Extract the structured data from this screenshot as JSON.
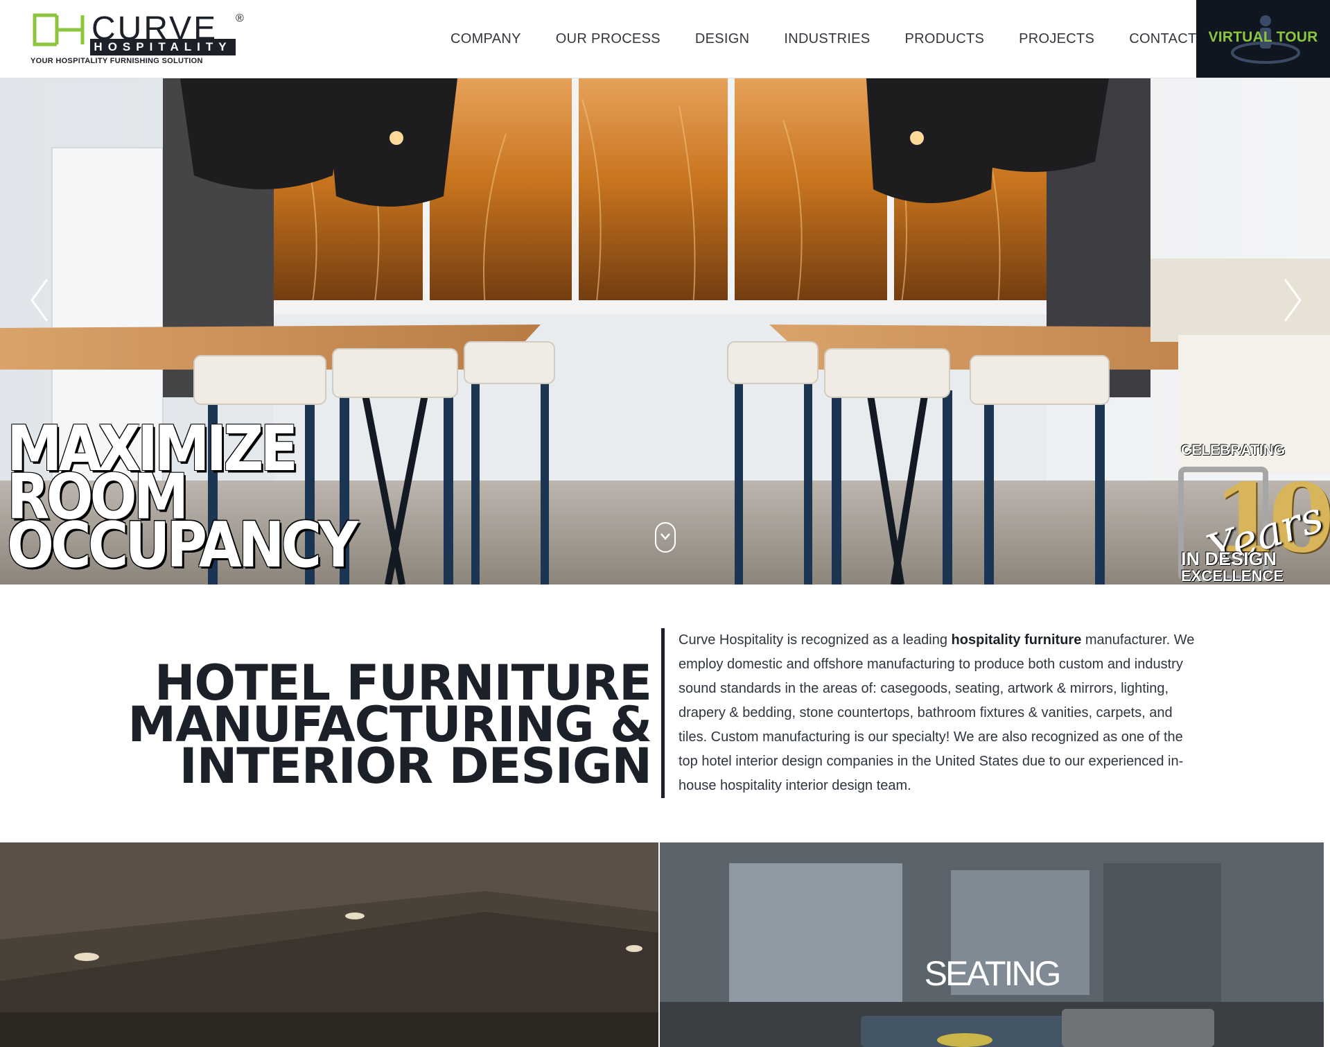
{
  "brand": {
    "name": "CURVE",
    "sub": "HOSPITALITY",
    "registered": "®",
    "tagline": "YOUR HOSPITALITY FURNISHING SOLUTION"
  },
  "nav": {
    "items": [
      {
        "label": "COMPANY"
      },
      {
        "label": "OUR PROCESS"
      },
      {
        "label": "DESIGN"
      },
      {
        "label": "INDUSTRIES"
      },
      {
        "label": "PRODUCTS"
      },
      {
        "label": "PROJECTS"
      },
      {
        "label": "CONTACT"
      }
    ],
    "virtual_tour": "VIRTUAL TOUR"
  },
  "hero": {
    "headline_lines": [
      "MAXIMIZE",
      "ROOM",
      "OCCUPANCY"
    ],
    "badge": {
      "top": "CELEBRATING",
      "number": "10",
      "script": "Years",
      "bottom1": "IN DESIGN",
      "bottom2": "EXCELLENCE"
    }
  },
  "intro": {
    "title_lines": [
      "HOTEL FURNITURE",
      "MANUFACTURING &",
      "INTERIOR DESIGN"
    ],
    "text_before": "Curve Hospitality is recognized as a leading ",
    "text_bold": "hospitality furniture",
    "text_after": " manufacturer. We employ domestic and offshore manufacturing to produce both custom and industry sound standards in the areas of: casegoods, seating, artwork & mirrors, lighting, drapery & bedding, stone countertops, bathroom fixtures & vanities, carpets, and tiles. Custom manufacturing is our specialty! We are also recognized as one of the top hotel interior design companies in the United States due to our experienced in-house hospitality interior design team."
  },
  "tiles": [
    {
      "label": ""
    },
    {
      "label": "SEATING"
    }
  ],
  "colors": {
    "accent_green": "#8cc63f",
    "dark_navy": "#1b2029",
    "virtual_tour_bg": "#0f1620"
  }
}
